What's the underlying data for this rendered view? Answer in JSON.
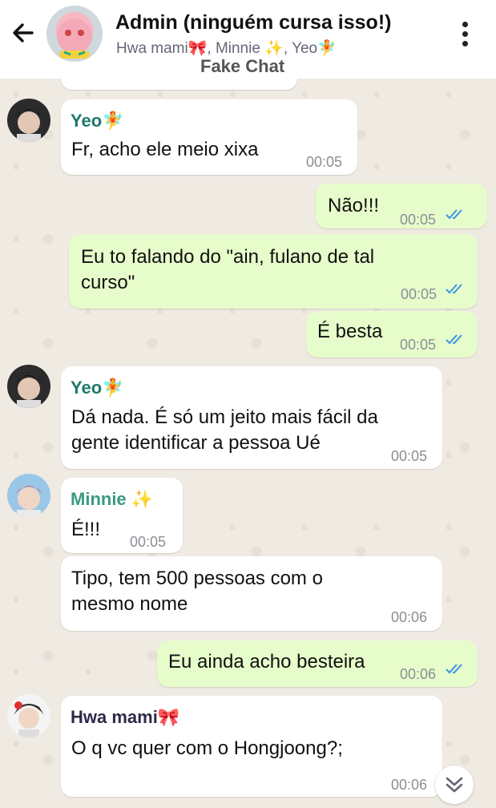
{
  "header": {
    "title": "Admin (ninguém cursa isso!)",
    "subtitle": "Hwa mami🎀, Minnie ✨, Yeo🧚",
    "overlay_label": "Fake Chat"
  },
  "colors": {
    "yeo": "#1f7a6a",
    "minnie": "#3a9a7f",
    "hwa": "#2e2a4a",
    "tick_read": "#3b96e6"
  },
  "messages": [
    {
      "sender": "Yeo🧚",
      "text": "Fr, acho ele meio xixa",
      "time": "00:05"
    },
    {
      "text": "Não!!!",
      "time": "00:05"
    },
    {
      "text": "Eu to falando do \"ain, fulano de tal\ncurso\"",
      "time": "00:05"
    },
    {
      "text": "É besta",
      "time": "00:05"
    },
    {
      "sender": "Yeo🧚",
      "text": "Dá nada. É só um jeito mais fácil da\ngente identificar a pessoa Ué",
      "time": "00:05"
    },
    {
      "sender": "Minnie ✨",
      "text": "É!!!",
      "time": "00:05"
    },
    {
      "text": "Tipo, tem 500 pessoas com o\nmesmo nome",
      "time": "00:06"
    },
    {
      "text": "Eu ainda acho besteira",
      "time": "00:06"
    },
    {
      "sender": "Hwa mami🎀",
      "text": "O q vc quer com o Hongjoong?;",
      "time": "00:06"
    }
  ]
}
